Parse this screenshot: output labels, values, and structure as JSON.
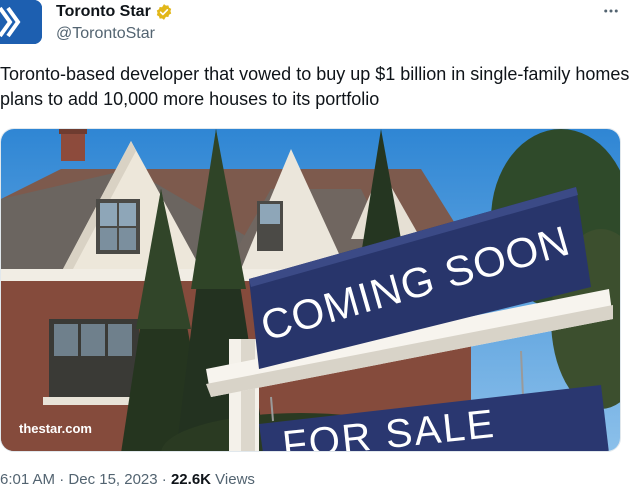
{
  "author": {
    "name": "Toronto Star",
    "handle": "@TorontoStar",
    "verified": true,
    "verified_color": "#e2b719",
    "avatar_color": "#1d5fb0"
  },
  "tweet": {
    "text": "Toronto-based developer that vowed to buy up $1 billion in single-family homes plans to add 10,000 more houses to its portfolio"
  },
  "media": {
    "sign_top_text": "COMING SOON",
    "sign_bottom_text": "FOR SALE",
    "watermark": "thestar.com"
  },
  "meta": {
    "time": "6:01 AM",
    "separator": "·",
    "date": "Dec 15, 2023",
    "views_count": "22.6K",
    "views_label": "Views"
  },
  "more_menu_icon": "more-horizontal-icon"
}
